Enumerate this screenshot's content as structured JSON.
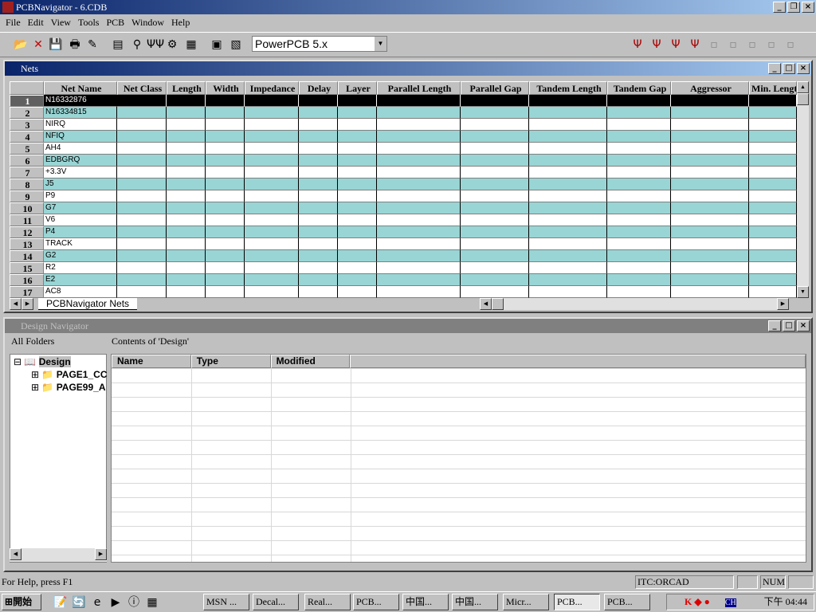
{
  "app": {
    "title": "PCBNavigator - 6.CDB"
  },
  "menu": [
    "File",
    "Edit",
    "View",
    "Tools",
    "PCB",
    "Window",
    "Help"
  ],
  "toolbar": {
    "left_icons": [
      "open-icon",
      "delete-icon",
      "save-icon",
      "print-icon",
      "edit-icon",
      "window-icon",
      "probe-icon",
      "nets-icon",
      "route-icon",
      "grid-icon",
      "export-icon",
      "import-icon"
    ],
    "combo_value": "PowerPCB 5.x",
    "right_icons": [
      "net-tool-1-icon",
      "net-tool-2-icon",
      "net-tool-3-icon",
      "net-tool-4-icon",
      "disabled-tool-1-icon",
      "disabled-tool-2-icon",
      "disabled-tool-3-icon",
      "disabled-tool-4-icon",
      "settings-icon"
    ]
  },
  "nets": {
    "title": "Nets",
    "columns": [
      "Net Name",
      "Net Class",
      "Length",
      "Width",
      "Impedance",
      "Delay",
      "Layer",
      "Parallel Length",
      "Parallel Gap",
      "Tandem Length",
      "Tandem Gap",
      "Aggressor",
      "Min. Length"
    ],
    "rows": [
      "N16332876",
      "N16334815",
      "NIRQ",
      "NFIQ",
      "AH4",
      "EDBGRQ",
      "+3.3V",
      "J5",
      "P9",
      "G7",
      "V6",
      "P4",
      "TRACK",
      "G2",
      "R2",
      "E2",
      "AC8"
    ],
    "sheet_tab": "PCBNavigator Nets",
    "colors": {
      "alt_row": "#99d5d5",
      "selected": "#000000"
    }
  },
  "design_nav": {
    "title": "Design Navigator",
    "folders_header": "All Folders",
    "contents_header": "Contents of 'Design'",
    "tree": [
      {
        "label": "Design"
      },
      {
        "label": "PAGE1_CC"
      },
      {
        "label": "PAGE99_A"
      }
    ],
    "list_columns": [
      "Name",
      "Type",
      "Modified"
    ]
  },
  "status": {
    "help": "For Help, press F1",
    "user": "ITC:ORCAD",
    "num": "NUM"
  },
  "taskbar": {
    "start": "開始",
    "tasks": [
      "MSN ...",
      "Decal...",
      "Real...",
      "PCB...",
      "中国...",
      "中国...",
      "Micr...",
      "PCB...",
      "PCB..."
    ],
    "ime": "CH",
    "clock": "下午 04:44"
  }
}
